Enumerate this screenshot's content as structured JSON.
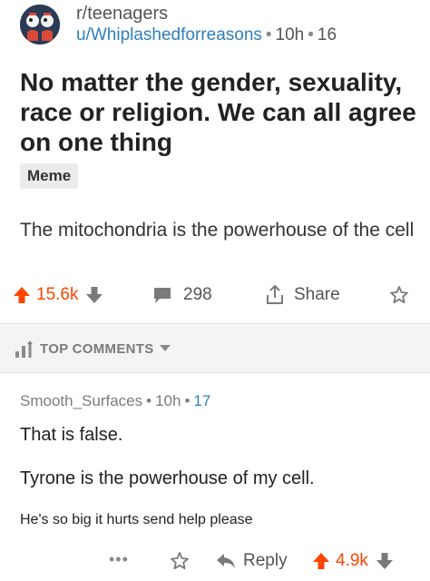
{
  "post": {
    "subreddit": "r/teenagers",
    "author": "u/Whiplashedforreasons",
    "separator": "•",
    "age": "10h",
    "score_small": "16",
    "title": "No matter the gender, sexuality, race or religion. We can all agree on one thing",
    "flair": "Meme",
    "body": "The mitochondria is the powerhouse of the cell"
  },
  "actions": {
    "score": "15.6k",
    "comments": "298",
    "share_label": "Share"
  },
  "sort": {
    "label": "TOP COMMENTS"
  },
  "comment": {
    "author": "Smooth_Surfaces",
    "separator": "•",
    "age": "10h",
    "score_small": "17",
    "paragraphs": [
      "That is false.",
      "Tyrone is the powerhouse of my cell.",
      "He's so big it hurts send help please"
    ],
    "more": "•••",
    "reply_label": "Reply",
    "score": "4.9k"
  },
  "colors": {
    "upvote": "#ff4500",
    "link_blue": "#2e7fbf",
    "muted": "#7c7c7c"
  },
  "icons": [
    "subreddit-avatar",
    "upvote-arrow-icon",
    "downvote-arrow-icon",
    "comment-bubble-icon",
    "share-icon",
    "save-star-icon",
    "sort-bars-icon",
    "chevron-down-icon",
    "more-dots-icon",
    "reply-arrow-icon"
  ]
}
